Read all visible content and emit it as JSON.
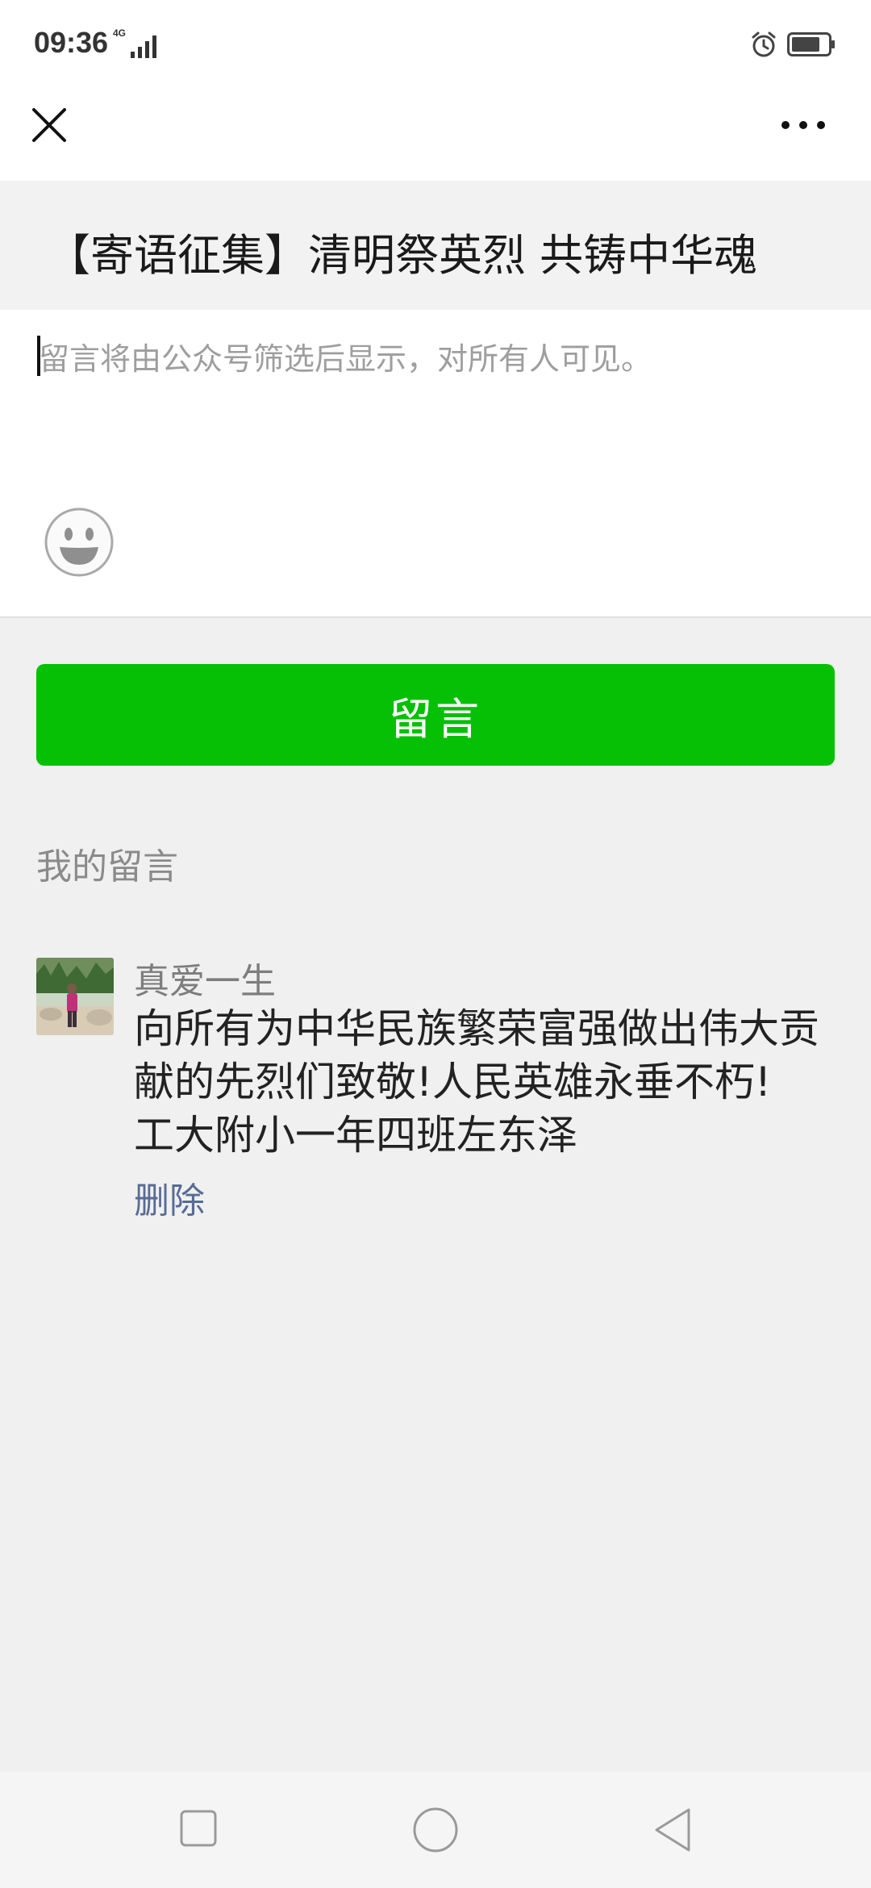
{
  "status_bar": {
    "time": "09:36",
    "network": "4G",
    "icons": [
      "signal-icon",
      "alarm-icon",
      "battery-icon"
    ]
  },
  "nav": {
    "close_icon": "close-icon",
    "more_icon": "more-icon"
  },
  "article": {
    "title": "【寄语征集】清明祭英烈 共铸中华魂"
  },
  "comment_box": {
    "placeholder": "留言将由公众号筛选后显示，对所有人可见。",
    "value": "",
    "emoji_icon": "emoji-icon"
  },
  "submit": {
    "label": "留言"
  },
  "my_comments": {
    "section_label": "我的留言",
    "items": [
      {
        "author": "真爱一生",
        "lines": [
          "向所有为中华民族繁荣富强做出伟大贡",
          "献的先烈们致敬!人民英雄永垂不朽!",
          "工大附小一年四班左东泽"
        ],
        "delete_label": "删除"
      }
    ]
  },
  "colors": {
    "accent_green": "#05c005",
    "link_blue": "#576b95",
    "page_bg": "#f0f0f0"
  }
}
